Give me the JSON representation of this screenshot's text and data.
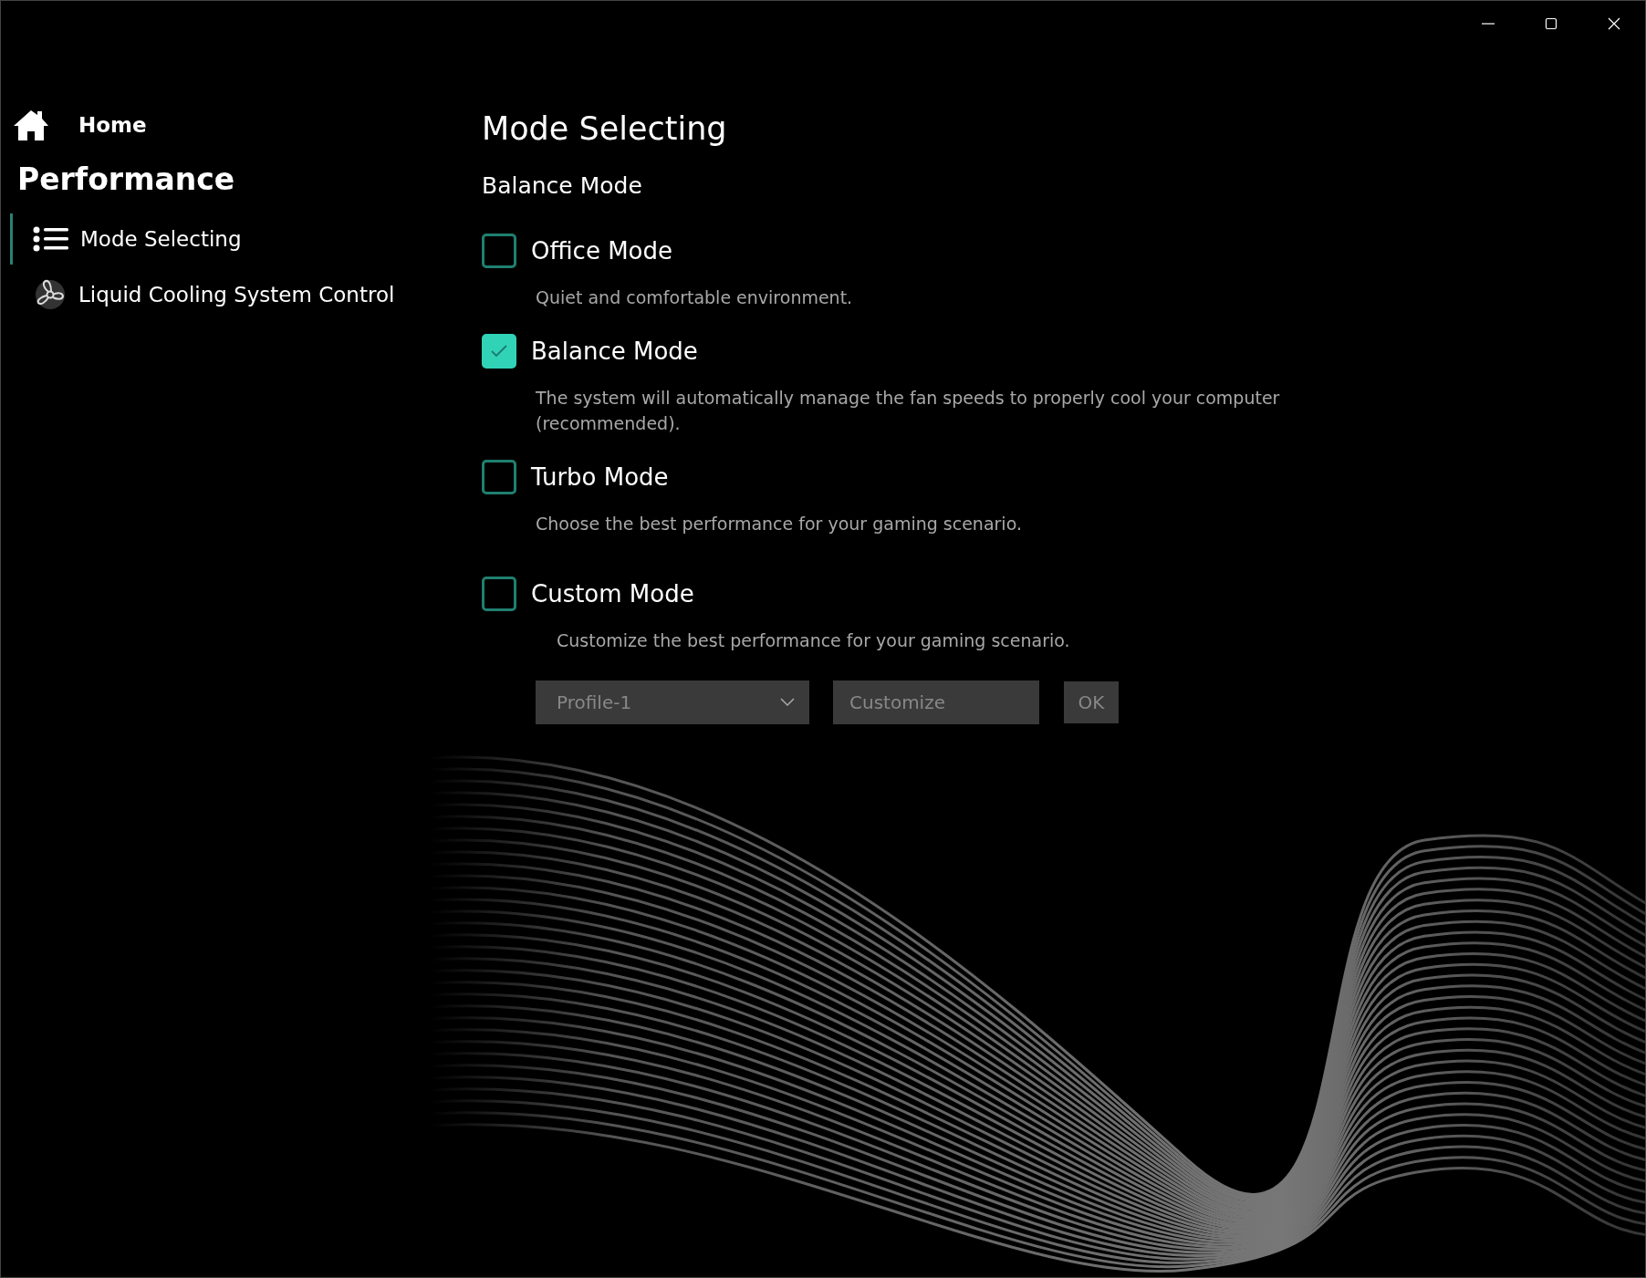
{
  "sidebar": {
    "home": {
      "label": "Home"
    },
    "section_title": "Performance",
    "items": [
      {
        "label": "Mode Selecting",
        "selected": true
      },
      {
        "label": "Liquid Cooling System Control",
        "selected": false
      }
    ]
  },
  "main": {
    "title": "Mode Selecting",
    "current_mode": "Balance Mode",
    "modes": [
      {
        "label": "Office Mode",
        "description": "Quiet and comfortable environment.",
        "checked": false
      },
      {
        "label": "Balance Mode",
        "description": "The system will automatically manage the fan speeds to properly cool your computer (recommended).",
        "checked": true
      },
      {
        "label": "Turbo Mode",
        "description": "Choose the best performance for your gaming scenario.",
        "checked": false
      },
      {
        "label": "Custom Mode",
        "description": "Customize the best performance for your gaming scenario.",
        "checked": false,
        "controls": {
          "profile": "Profile-1",
          "field": {
            "placeholder": "Customize"
          },
          "button": "OK"
        }
      }
    ]
  }
}
